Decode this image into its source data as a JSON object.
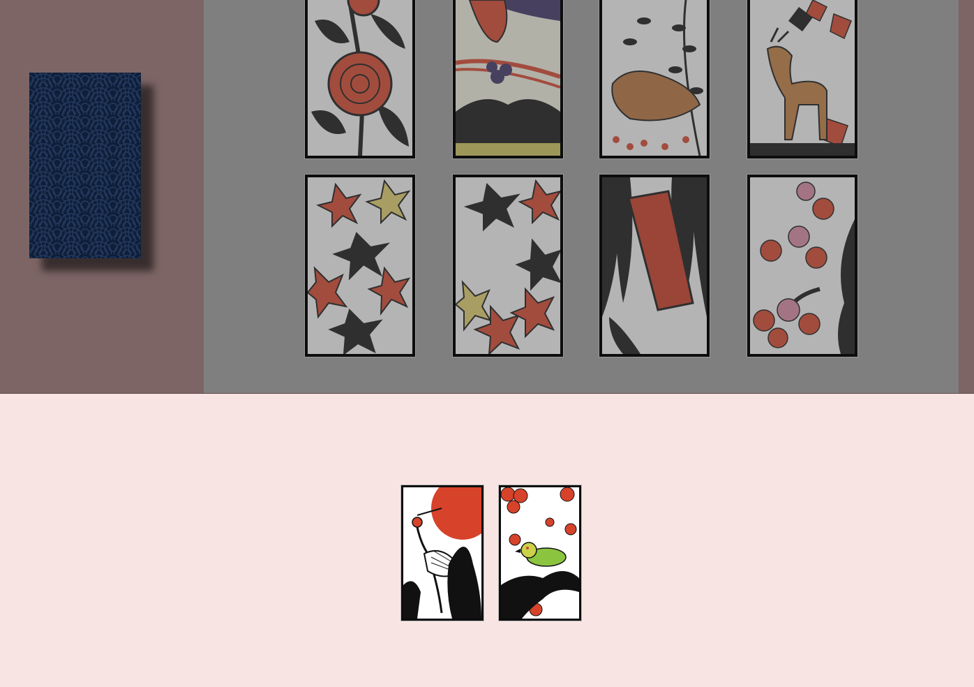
{
  "colors": {
    "table_top": "#7d6565",
    "field_overlay": "#7f7f7f",
    "player_area": "#f9e4e4",
    "deck_back": "#0f1f3a",
    "card_red": "#d6432a",
    "card_black": "#111111"
  },
  "deck": {
    "icon": "seigaiha-card-back"
  },
  "field": {
    "cards": [
      {
        "month": "peony",
        "kind": "plain",
        "icon": "peony-card-icon"
      },
      {
        "month": "paulownia",
        "kind": "phoenix",
        "icon": "phoenix-card-icon"
      },
      {
        "month": "bush-clover",
        "kind": "boar",
        "icon": "boar-card-icon"
      },
      {
        "month": "maple",
        "kind": "deer",
        "icon": "deer-card-icon"
      },
      {
        "month": "maple",
        "kind": "plain",
        "icon": "maple-card-icon"
      },
      {
        "month": "maple",
        "kind": "plain",
        "icon": "maple-card-icon"
      },
      {
        "month": "willow",
        "kind": "ribbon",
        "icon": "willow-ribbon-card-icon"
      },
      {
        "month": "cherry",
        "kind": "plain",
        "icon": "cherry-card-icon"
      }
    ]
  },
  "hand": {
    "cards": [
      {
        "month": "pine",
        "kind": "crane",
        "icon": "crane-sun-card-icon"
      },
      {
        "month": "plum",
        "kind": "warbler",
        "icon": "warbler-card-icon"
      }
    ]
  }
}
